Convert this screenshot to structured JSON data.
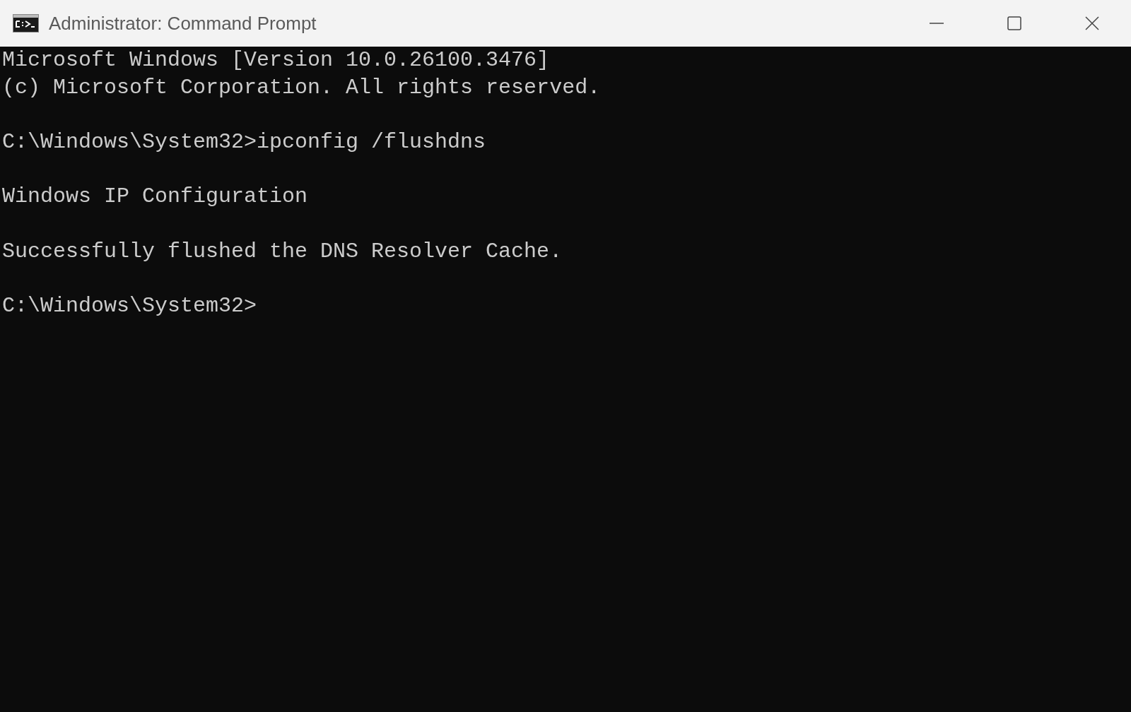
{
  "window": {
    "title": "Administrator: Command Prompt"
  },
  "console": {
    "blocks": [
      {
        "lines": [
          "Microsoft Windows [Version 10.0.26100.3476]",
          "(c) Microsoft Corporation. All rights reserved."
        ]
      },
      {
        "lines": [
          "C:\\Windows\\System32>ipconfig /flushdns"
        ]
      },
      {
        "lines": [
          "Windows IP Configuration"
        ]
      },
      {
        "lines": [
          "Successfully flushed the DNS Resolver Cache."
        ]
      },
      {
        "lines": [
          "C:\\Windows\\System32>"
        ]
      }
    ]
  }
}
